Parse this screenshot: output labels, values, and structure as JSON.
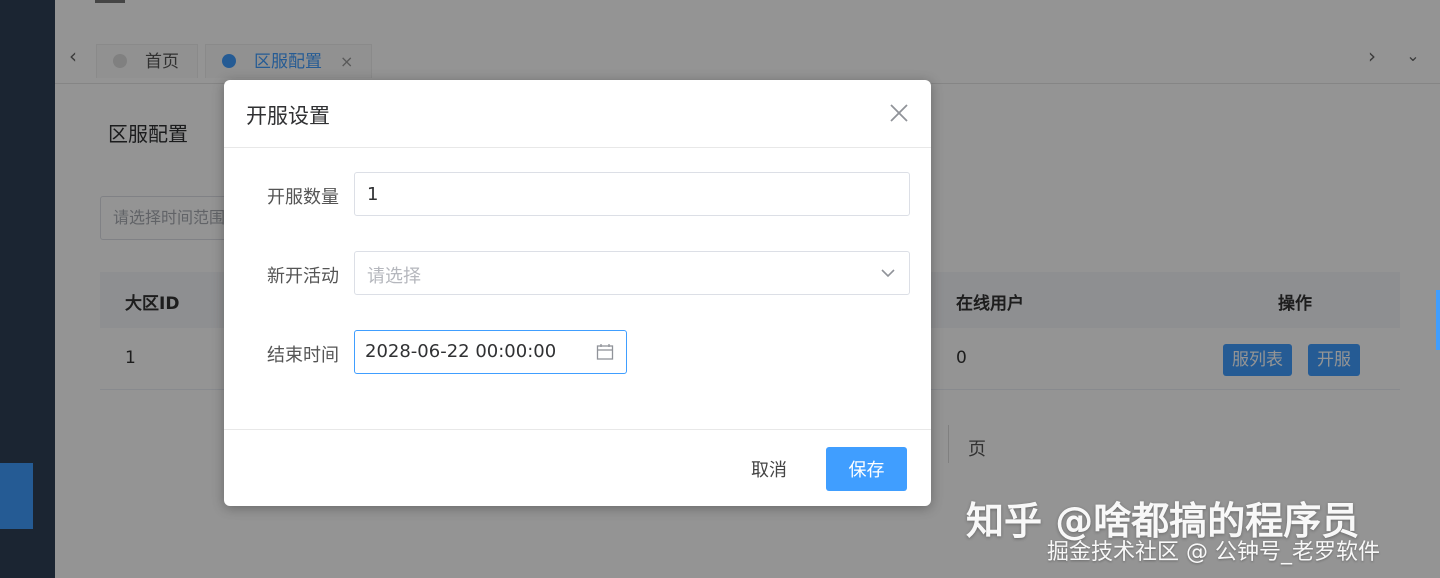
{
  "tabs": [
    {
      "label": "首页",
      "dot_color": "#dcdcdc",
      "active": false
    },
    {
      "label": "区服配置",
      "dot_color": "#409eff",
      "active": true,
      "close": "×"
    }
  ],
  "page": {
    "title": "区服配置",
    "date_filter_placeholder": "请选择时间范围"
  },
  "table": {
    "headers": {
      "region_id": "大区ID",
      "online_users": "在线用户",
      "actions": "操作"
    },
    "rows": [
      {
        "region_id": "1",
        "online_users": "0",
        "btn_server_list": "服列表",
        "btn_open": "开服"
      }
    ]
  },
  "pager": {
    "page_suffix": "页"
  },
  "dialog": {
    "title": "开服设置",
    "fields": {
      "count_label": "开服数量",
      "count_value": "1",
      "activity_label": "新开活动",
      "activity_placeholder": "请选择",
      "end_label": "结束时间",
      "end_value": "2028-06-22 00:00:00"
    },
    "cancel_label": "取消",
    "save_label": "保存"
  },
  "watermark": {
    "main": "知乎 @啥都搞的程序员",
    "sub": "掘金技术社区 @ 公钟号_老罗软件"
  },
  "colors": {
    "primary": "#409eff",
    "sidebar": "#304156",
    "overlay": "rgba(0,0,0,0.42)"
  }
}
